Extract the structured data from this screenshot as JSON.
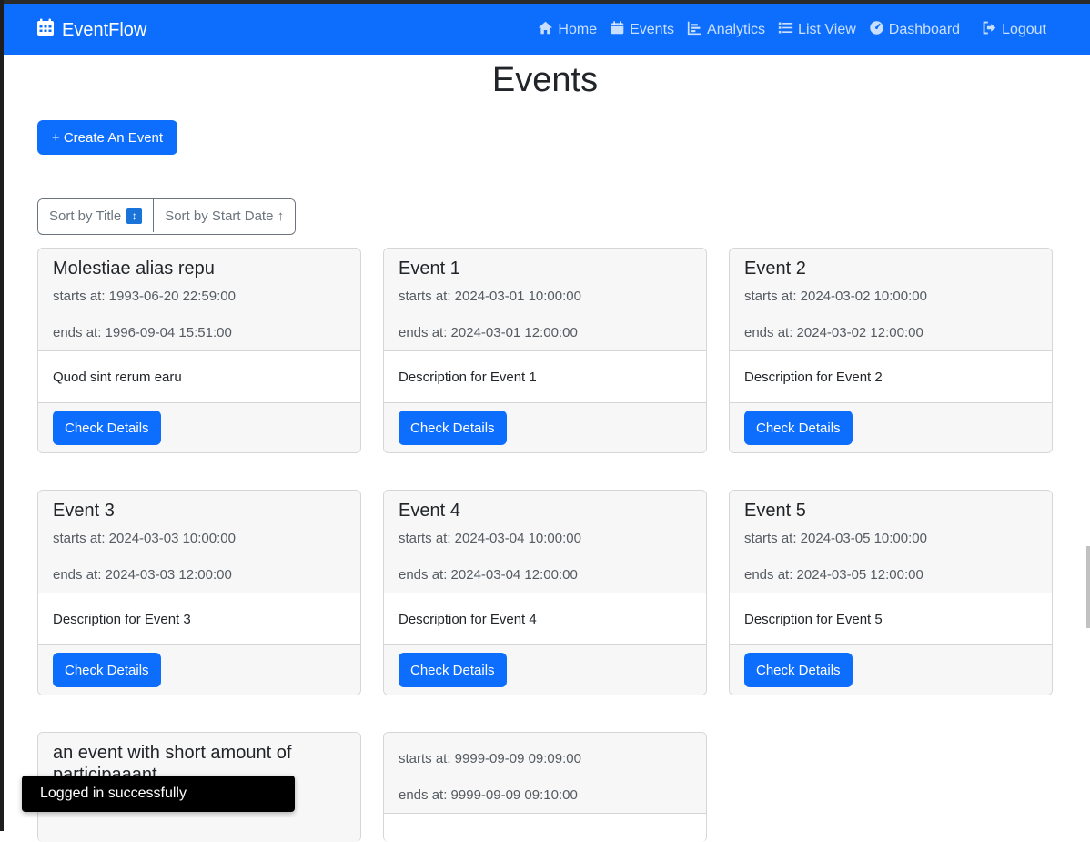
{
  "navbar": {
    "brand": "EventFlow",
    "links": [
      {
        "label": "Home",
        "icon": "home-icon"
      },
      {
        "label": "Events",
        "icon": "calendar-icon"
      },
      {
        "label": "Analytics",
        "icon": "chart-icon"
      },
      {
        "label": "List View",
        "icon": "list-icon"
      },
      {
        "label": "Dashboard",
        "icon": "gauge-icon"
      }
    ],
    "logout": "Logout"
  },
  "page": {
    "title": "Events",
    "create_button": "+ Create An Event",
    "sort_title": "Sort by Title",
    "sort_title_badge": "↕",
    "sort_date": "Sort by Start Date ↑"
  },
  "events": [
    {
      "title": "Molestiae alias repu",
      "starts": "starts at: 1993-06-20 22:59:00",
      "ends": "ends at: 1996-09-04 15:51:00",
      "description": "Quod sint rerum earu",
      "button": "Check Details"
    },
    {
      "title": "Event 1",
      "starts": "starts at: 2024-03-01 10:00:00",
      "ends": "ends at: 2024-03-01 12:00:00",
      "description": "Description for Event 1",
      "button": "Check Details"
    },
    {
      "title": "Event 2",
      "starts": "starts at: 2024-03-02 10:00:00",
      "ends": "ends at: 2024-03-02 12:00:00",
      "description": "Description for Event 2",
      "button": "Check Details"
    },
    {
      "title": "Event 3",
      "starts": "starts at: 2024-03-03 10:00:00",
      "ends": "ends at: 2024-03-03 12:00:00",
      "description": "Description for Event 3",
      "button": "Check Details"
    },
    {
      "title": "Event 4",
      "starts": "starts at: 2024-03-04 10:00:00",
      "ends": "ends at: 2024-03-04 12:00:00",
      "description": "Description for Event 4",
      "button": "Check Details"
    },
    {
      "title": "Event 5",
      "starts": "starts at: 2024-03-05 10:00:00",
      "ends": "ends at: 2024-03-05 12:00:00",
      "description": "Description for Event 5",
      "button": "Check Details"
    },
    {
      "title": "an event with short amount of participaaant",
      "starts": "",
      "ends": "",
      "description": "",
      "button": ""
    },
    {
      "title": "",
      "starts": "starts at: 9999-09-09 09:09:00",
      "ends": "ends at: 9999-09-09 09:10:00",
      "description": "",
      "button": ""
    }
  ],
  "toast": {
    "message": "Logged in successfully"
  },
  "colors": {
    "primary": "#0d6efd",
    "toast_bg": "#000000"
  }
}
